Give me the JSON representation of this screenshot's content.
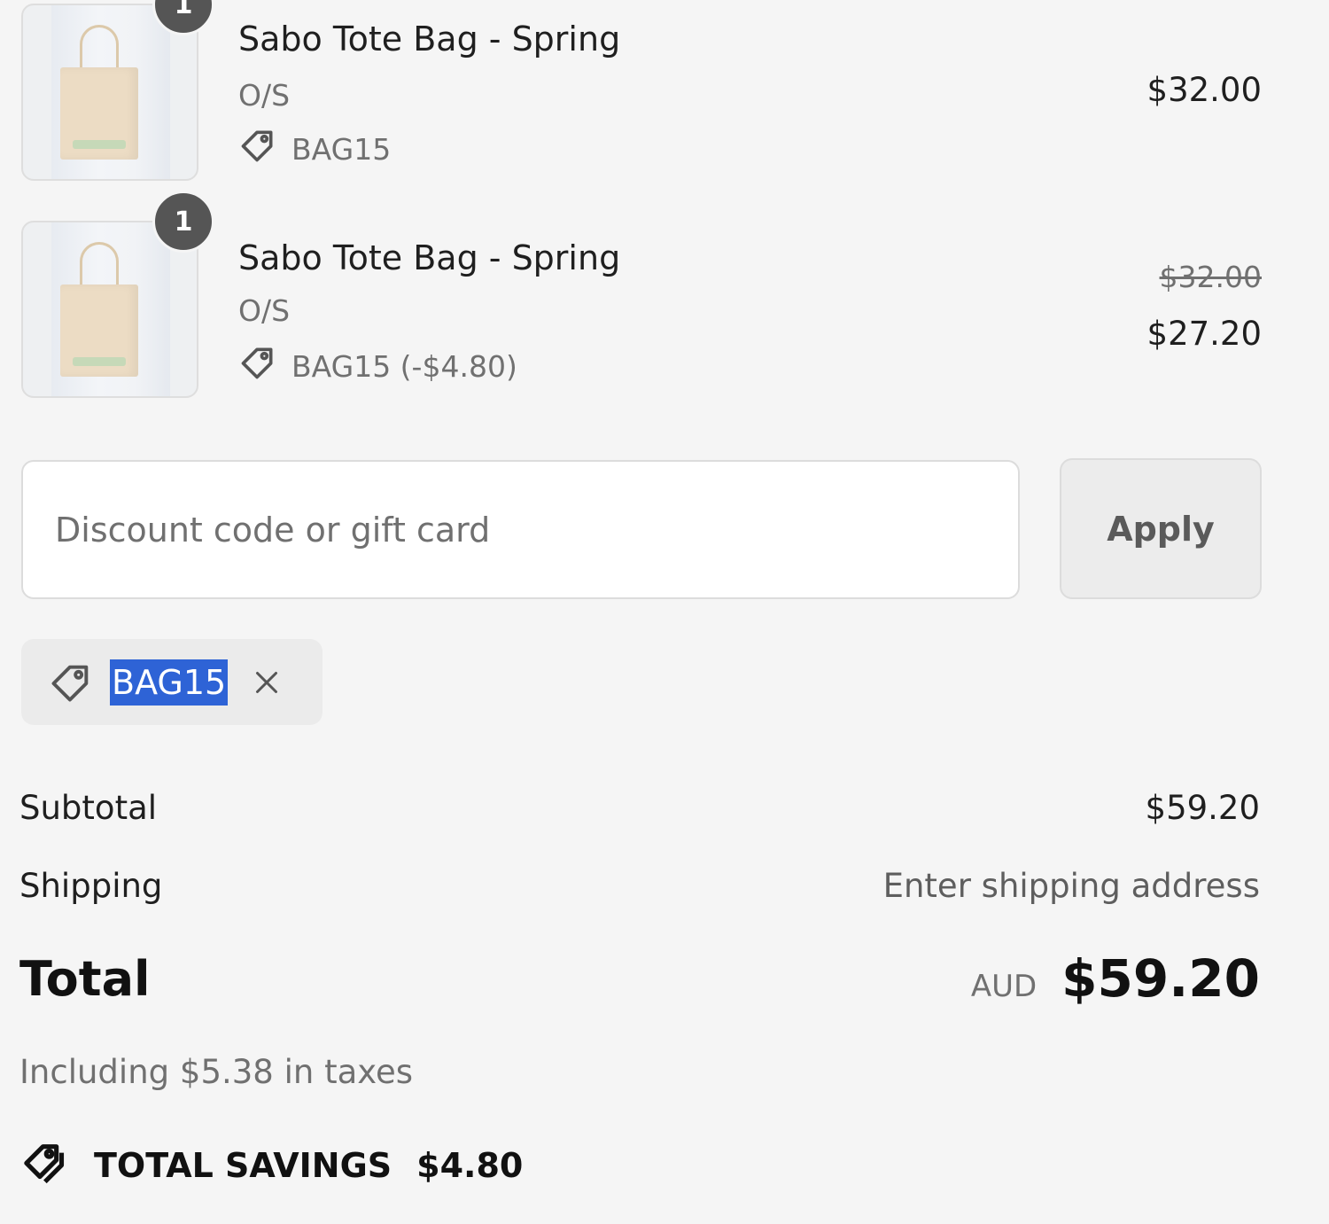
{
  "line_items": [
    {
      "quantity": "1",
      "title": "Sabo Tote Bag - Spring",
      "variant": "O/S",
      "discount": "BAG15",
      "price": "$32.00"
    },
    {
      "quantity": "1",
      "title": "Sabo Tote Bag - Spring",
      "variant": "O/S",
      "discount": "BAG15 (-$4.80)",
      "original_price": "$32.00",
      "price": "$27.20"
    }
  ],
  "discount": {
    "placeholder": "Discount code or gift card",
    "apply_label": "Apply",
    "applied_code": "BAG15"
  },
  "summary": {
    "subtotal_label": "Subtotal",
    "subtotal_value": "$59.20",
    "shipping_label": "Shipping",
    "shipping_value": "Enter shipping address",
    "total_label": "Total",
    "currency": "AUD",
    "total_value": "$59.20",
    "taxes_note": "Including $5.38 in taxes",
    "savings_label": "TOTAL SAVINGS",
    "savings_value": "$4.80"
  },
  "icons": {
    "tag": "tag-icon",
    "remove": "close-icon",
    "savings": "savings-tag-icon"
  },
  "colors": {
    "background": "#f5f5f5",
    "badge": "#555555",
    "selection": "#2e63d6",
    "muted_text": "#707070"
  }
}
